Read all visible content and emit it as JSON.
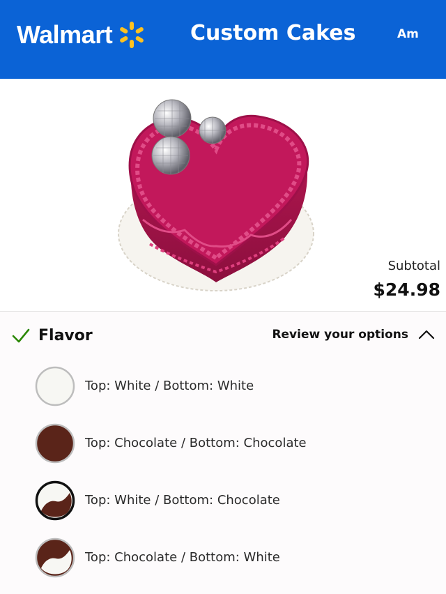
{
  "header": {
    "brand": "Walmart",
    "title": "Custom Cakes",
    "user": "Am"
  },
  "product": {
    "subtotal_label": "Subtotal",
    "subtotal_value": "$24.98"
  },
  "flavor_section": {
    "title": "Flavor",
    "review_label": "Review your options",
    "options": [
      {
        "label": "Top: White / Bottom: White",
        "selected": false
      },
      {
        "label": "Top: Chocolate / Bottom: Chocolate",
        "selected": false
      },
      {
        "label": "Top: White / Bottom: Chocolate",
        "selected": true
      },
      {
        "label": "Top: Chocolate / Bottom: White",
        "selected": false
      }
    ]
  },
  "colors": {
    "header_bg": "#0b63d6",
    "spark": "#ffc220",
    "check": "#2a8703",
    "chocolate": "#5a2419",
    "white_cake": "#f7f7f3",
    "cake_pink": "#c2185b"
  },
  "icons": {
    "brand": "spark-icon",
    "section": "check-icon",
    "toggle": "chevron-up-icon"
  }
}
